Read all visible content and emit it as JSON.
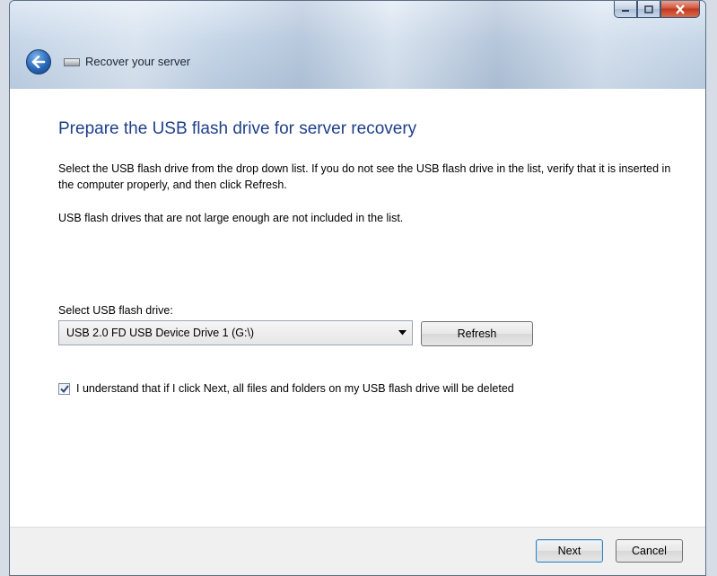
{
  "window": {
    "title": "Recover your server",
    "accent": "#1e3f8a"
  },
  "icons": {
    "back": "back-arrow-icon",
    "wizard": "server-icon",
    "minimize": "minimize-icon",
    "maximize": "maximize-icon",
    "close": "close-icon",
    "dropdown": "chevron-down-icon",
    "check": "checkmark-icon"
  },
  "main": {
    "heading": "Prepare the USB flash drive for server recovery",
    "instructions": "Select the USB flash drive from the drop down list. If you do not see the USB flash drive in the list, verify that it is inserted in the computer properly, and then click Refresh.",
    "note": "USB flash drives that are not large enough are not included in the list.",
    "select_label": "Select USB flash drive:",
    "select_value": "USB 2.0 FD USB Device Drive 1 (G:\\)",
    "refresh_label": "Refresh",
    "checkbox_checked": true,
    "checkbox_label": "I understand that if I click Next, all files and folders on my USB flash drive will be deleted"
  },
  "footer": {
    "next_label": "Next",
    "cancel_label": "Cancel"
  }
}
